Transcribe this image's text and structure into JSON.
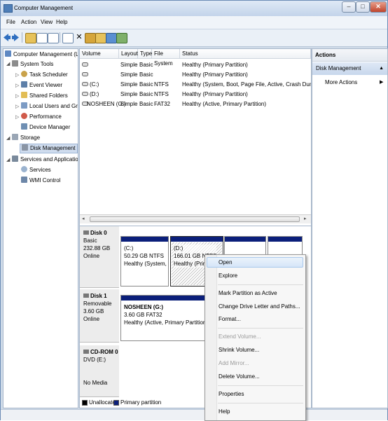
{
  "window": {
    "title": "Computer Management",
    "minimize": "–",
    "maximize": "□",
    "close": "✕"
  },
  "menu": [
    "File",
    "Action",
    "View",
    "Help"
  ],
  "tree": {
    "root": "Computer Management (Local",
    "system_tools": "System Tools",
    "task_scheduler": "Task Scheduler",
    "event_viewer": "Event Viewer",
    "shared_folders": "Shared Folders",
    "local_users": "Local Users and Groups",
    "performance": "Performance",
    "device_manager": "Device Manager",
    "storage": "Storage",
    "disk_management": "Disk Management",
    "services_apps": "Services and Applications",
    "services": "Services",
    "wmi": "WMI Control"
  },
  "volume_list": {
    "headers": [
      "Volume",
      "Layout",
      "Type",
      "File System",
      "Status"
    ],
    "rows": [
      {
        "volume": "",
        "layout": "Simple",
        "type": "Basic",
        "fs": "",
        "status": "Healthy (Primary Partition)"
      },
      {
        "volume": "",
        "layout": "Simple",
        "type": "Basic",
        "fs": "",
        "status": "Healthy (Primary Partition)"
      },
      {
        "volume": "(C:)",
        "layout": "Simple",
        "type": "Basic",
        "fs": "NTFS",
        "status": "Healthy (System, Boot, Page File, Active, Crash Dump, Primary"
      },
      {
        "volume": "(D:)",
        "layout": "Simple",
        "type": "Basic",
        "fs": "NTFS",
        "status": "Healthy (Primary Partition)"
      },
      {
        "volume": "NOSHEEN (G:)",
        "layout": "Simple",
        "type": "Basic",
        "fs": "FAT32",
        "status": "Healthy (Active, Primary Partition)"
      }
    ]
  },
  "disks": {
    "disk0": {
      "name": "Disk 0",
      "kind": "Basic",
      "size": "232.88 GB",
      "state": "Online"
    },
    "c": {
      "label": "(C:)",
      "size": "50.29 GB NTFS",
      "status": "Healthy (System, Boo"
    },
    "d": {
      "label": "(D:)",
      "size": "166.01 GB NTFS",
      "status": "Healthy (Prima"
    },
    "disk1": {
      "name": "Disk 1",
      "kind": "Removable",
      "size": "3.60 GB",
      "state": "Online"
    },
    "g": {
      "label": "NOSHEEN (G:)",
      "size": "3.60 GB FAT32",
      "status": "Healthy (Active, Primary Partition)"
    },
    "cdrom": {
      "name": "CD-ROM 0",
      "kind": "DVD (E:)",
      "state": "No Media"
    }
  },
  "legend": {
    "unallocated": "Unallocated",
    "primary": "Primary partition"
  },
  "actions": {
    "header": "Actions",
    "selected": "Disk Management",
    "more": "More Actions"
  },
  "context_menu": {
    "open": "Open",
    "explore": "Explore",
    "mark_active": "Mark Partition as Active",
    "change_letter": "Change Drive Letter and Paths...",
    "format": "Format...",
    "extend": "Extend Volume...",
    "shrink": "Shrink Volume...",
    "add_mirror": "Add Mirror...",
    "delete": "Delete Volume...",
    "properties": "Properties",
    "help": "Help"
  },
  "colors": {
    "primary_partition": "#0b1f7a",
    "unallocated": "#000000",
    "selection": "#c7d7ec"
  }
}
